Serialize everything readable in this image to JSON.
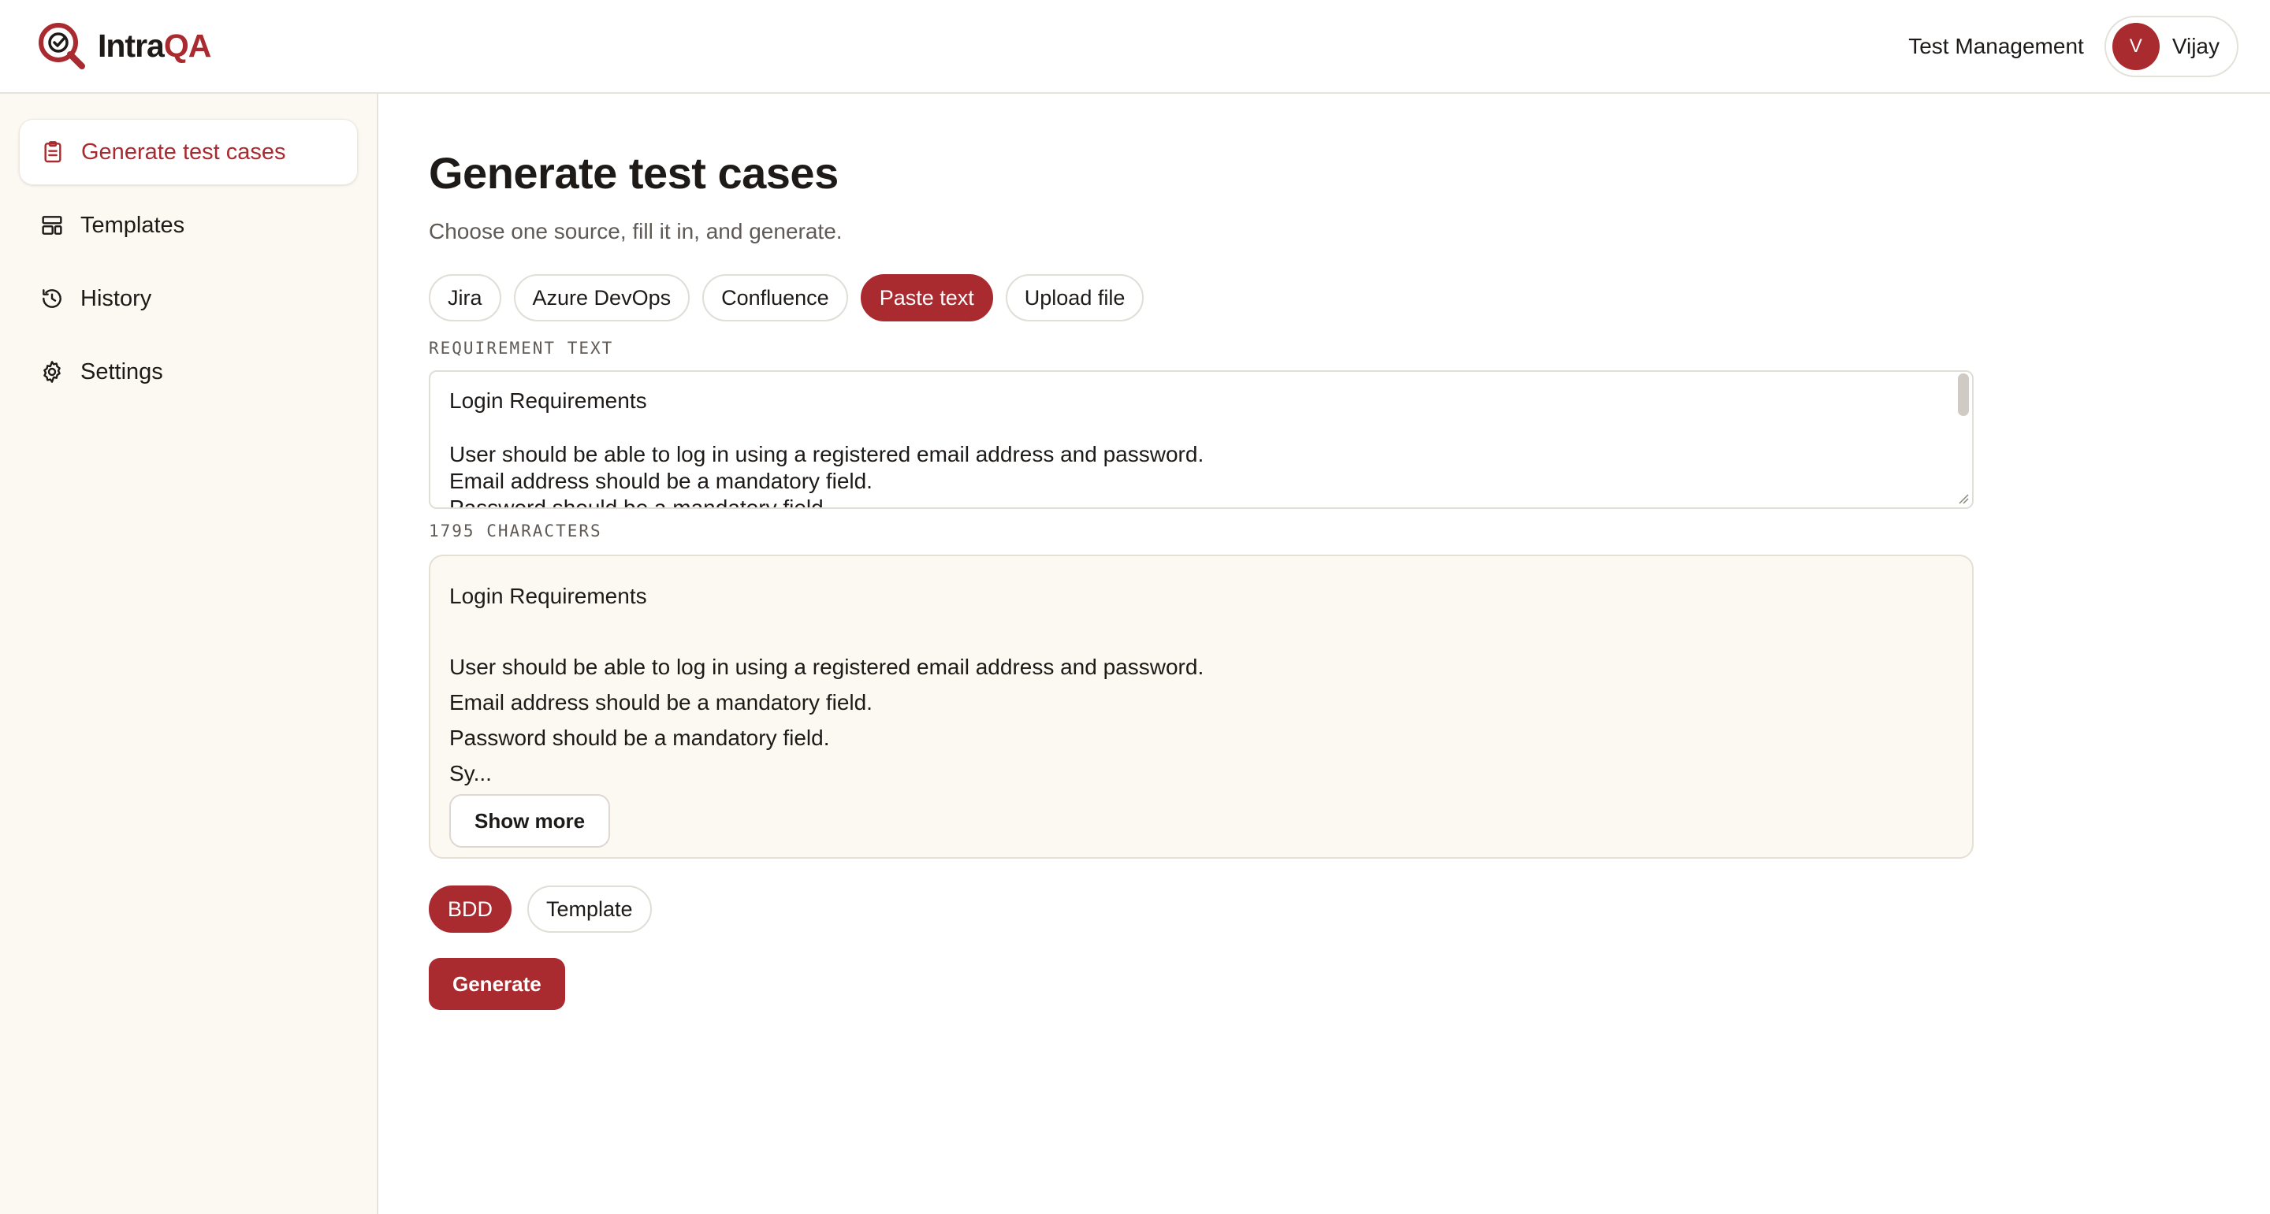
{
  "header": {
    "brand_prefix": "Intra",
    "brand_suffix": "QA",
    "nav_link": "Test Management",
    "user_initial": "V",
    "user_name": "Vijay"
  },
  "sidebar": {
    "items": [
      {
        "label": "Generate test cases",
        "icon": "clipboard-icon",
        "active": true
      },
      {
        "label": "Templates",
        "icon": "layout-icon",
        "active": false
      },
      {
        "label": "History",
        "icon": "history-icon",
        "active": false
      },
      {
        "label": "Settings",
        "icon": "gear-icon",
        "active": false
      }
    ]
  },
  "main": {
    "title": "Generate test cases",
    "subtitle": "Choose one source, fill it in, and generate.",
    "sources": [
      {
        "label": "Jira",
        "selected": false
      },
      {
        "label": "Azure DevOps",
        "selected": false
      },
      {
        "label": "Confluence",
        "selected": false
      },
      {
        "label": "Paste text",
        "selected": true
      },
      {
        "label": "Upload file",
        "selected": false
      }
    ],
    "requirement_label": "REQUIREMENT TEXT",
    "requirement_lines": [
      "Login Requirements",
      "",
      "User should be able to log in using a registered email address and password.",
      "Email address should be a mandatory field.",
      "Password should be a mandatory field."
    ],
    "char_count": "1795 CHARACTERS",
    "preview_lines": [
      "Login Requirements",
      "",
      "User should be able to log in using a registered email address and password.",
      "Email address should be a mandatory field.",
      "Password should be a mandatory field.",
      "Sy..."
    ],
    "show_more_label": "Show more",
    "formats": [
      {
        "label": "BDD",
        "selected": true
      },
      {
        "label": "Template",
        "selected": false
      }
    ],
    "generate_label": "Generate"
  },
  "colors": {
    "accent": "#a92a2f",
    "sidebar_bg": "#fcf8f2",
    "text": "#1d1a18",
    "muted": "#5f5a55"
  }
}
